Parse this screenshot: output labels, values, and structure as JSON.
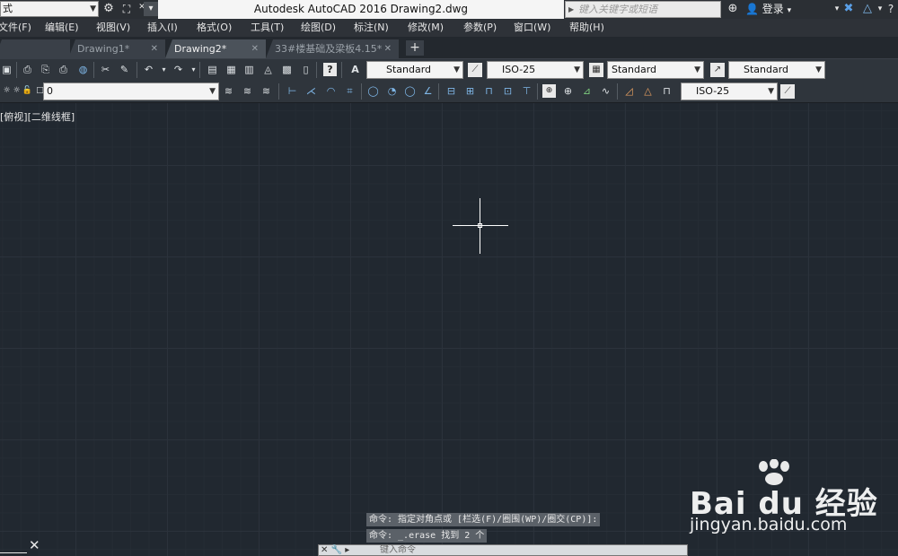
{
  "titlebar": {
    "workspace": "式",
    "app_title": "Autodesk AutoCAD 2016    Drawing2.dwg",
    "search_placeholder": "键入关键字或短语",
    "login": "登录"
  },
  "menu": {
    "items": [
      "文件(F)",
      "编辑(E)",
      "视图(V)",
      "插入(I)",
      "格式(O)",
      "工具(T)",
      "绘图(D)",
      "标注(N)",
      "修改(M)",
      "参数(P)",
      "窗口(W)",
      "帮助(H)"
    ]
  },
  "tabs": {
    "items": [
      {
        "label": "Drawing1*",
        "active": false
      },
      {
        "label": "Drawing2*",
        "active": true
      },
      {
        "label": "33#楼基础及梁板4.15*",
        "active": false
      }
    ],
    "add_label": "+"
  },
  "toolbar": {
    "text_style": "Standard",
    "dim_style": "ISO-25",
    "table_style": "Standard",
    "mleader_style": "Standard",
    "layer": "0",
    "dim_style2": "ISO-25"
  },
  "viewport": {
    "label": "[俯视][二维线框]"
  },
  "command": {
    "history": [
      "命令: 指定对角点或 [栏选(F)/圈围(WP)/圈交(CP)]:",
      "命令: _.erase 找到 2 个"
    ],
    "placeholder": "键入命令"
  },
  "watermark": {
    "brand": "Bai du 经验",
    "url": "jingyan.baidu.com"
  },
  "colors": {
    "canvas": "#212830",
    "grid_major": "#2b323b",
    "grid_minor": "#252c34",
    "toolbar": "#2f353c",
    "crosshair": "#ffffff"
  }
}
